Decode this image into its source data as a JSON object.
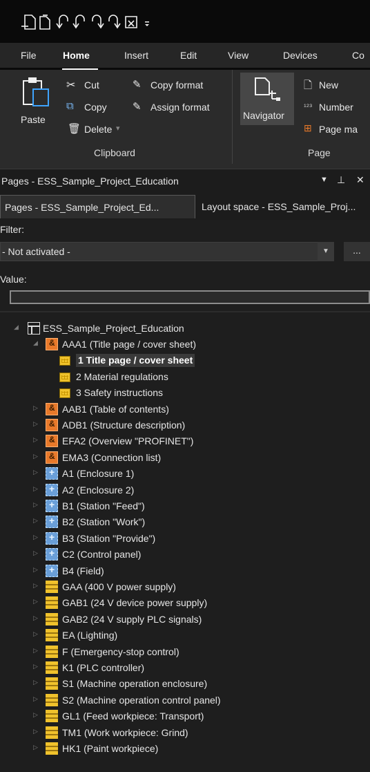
{
  "quick_access": {
    "icons": [
      "new-page-icon",
      "copy-page-icon",
      "undo-icon",
      "undo-alt-icon",
      "redo-icon",
      "redo-alt-icon",
      "form-icon",
      "customize-icon"
    ]
  },
  "menu_tabs": [
    "File",
    "Home",
    "Insert",
    "Edit",
    "View",
    "Devices",
    "Co"
  ],
  "ribbon": {
    "paste": "Paste",
    "cut": "Cut",
    "copy": "Copy",
    "delete": "Delete",
    "copy_format": "Copy format",
    "assign_format": "Assign format",
    "clipboard_group": "Clipboard",
    "navigator": "Navigator",
    "new": "New",
    "number": "Number",
    "page_ma": "Page ma",
    "page_group": "Page"
  },
  "panel": {
    "title": "Pages - ESS_Sample_Project_Education",
    "tab1": "Pages - ESS_Sample_Project_Ed...",
    "tab2": "Layout space - ESS_Sample_Proj...",
    "filter_label": "Filter:",
    "filter_value": "- Not activated -",
    "more": "...",
    "value_label": "Value:"
  },
  "tree": {
    "root": "ESS_Sample_Project_Education",
    "items": [
      {
        "label": "AAA1 (Title page / cover sheet)",
        "type": "orange",
        "level": 1,
        "expanded": true
      },
      {
        "label": "1 Title page / cover sheet",
        "type": "page",
        "level": 2,
        "selected": true
      },
      {
        "label": "2 Material regulations",
        "type": "page",
        "level": 2
      },
      {
        "label": "3 Safety instructions",
        "type": "page",
        "level": 2
      },
      {
        "label": "AAB1 (Table of contents)",
        "type": "orange",
        "level": 1
      },
      {
        "label": "ADB1 (Structure description)",
        "type": "orange",
        "level": 1
      },
      {
        "label": "EFA2 (Overview \"PROFINET\")",
        "type": "orange",
        "level": 1
      },
      {
        "label": "EMA3 (Connection list)",
        "type": "orange",
        "level": 1
      },
      {
        "label": "A1 (Enclosure 1)",
        "type": "blue",
        "level": 1
      },
      {
        "label": "A2 (Enclosure 2)",
        "type": "blue",
        "level": 1
      },
      {
        "label": "B1 (Station \"Feed\")",
        "type": "blue",
        "level": 1
      },
      {
        "label": "B2 (Station \"Work\")",
        "type": "blue",
        "level": 1
      },
      {
        "label": "B3 (Station \"Provide\")",
        "type": "blue",
        "level": 1
      },
      {
        "label": "C2 (Control panel)",
        "type": "blue",
        "level": 1
      },
      {
        "label": "B4 (Field)",
        "type": "blue",
        "level": 1
      },
      {
        "label": "GAA (400 V power supply)",
        "type": "yellow",
        "level": 1
      },
      {
        "label": "GAB1 (24 V device power supply)",
        "type": "yellow",
        "level": 1
      },
      {
        "label": "GAB2 (24 V supply PLC signals)",
        "type": "yellow",
        "level": 1
      },
      {
        "label": "EA (Lighting)",
        "type": "yellow",
        "level": 1
      },
      {
        "label": "F (Emergency-stop control)",
        "type": "yellow",
        "level": 1
      },
      {
        "label": "K1 (PLC controller)",
        "type": "yellow",
        "level": 1
      },
      {
        "label": "S1 (Machine operation enclosure)",
        "type": "yellow",
        "level": 1
      },
      {
        "label": "S2 (Machine operation control panel)",
        "type": "yellow",
        "level": 1
      },
      {
        "label": "GL1 (Feed workpiece: Transport)",
        "type": "yellow",
        "level": 1
      },
      {
        "label": "TM1 (Work workpiece: Grind)",
        "type": "yellow",
        "level": 1
      },
      {
        "label": "HK1 (Paint workpiece)",
        "type": "yellow",
        "level": 1
      }
    ]
  }
}
